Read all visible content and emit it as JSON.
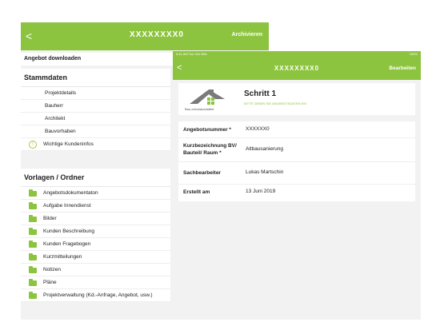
{
  "back": {
    "title": "XXXXXXXX0",
    "back_glyph": "<",
    "action": "Archivieren",
    "download": "Angebot downloaden",
    "stammdaten": {
      "title": "Stammdaten",
      "items": [
        "Projektdetails",
        "Bauherr",
        "Architekt",
        "Bauvorhaben"
      ],
      "info_item": "Wichtige Kundeninfos"
    },
    "vorlagen": {
      "title": "Vorlagen / Ordner",
      "items": [
        "Angebotsdokumentaton",
        "Aufgabe Innendienst",
        "Bilder",
        "Kunden Beschreibung",
        "Kunden Fragebogen",
        "Kurzmitteilungen",
        "Notizen",
        "Pläne",
        "Projektverwaltung (Kd.-Anfrage, Angebot, usw.)"
      ]
    }
  },
  "front": {
    "status_left": "9:41 AM  Tue Oct 30th",
    "status_right": "100%",
    "title": "XXXXXXXX0",
    "back_glyph": "<",
    "edit": "Bearbeiten",
    "logo_text": "Bau-checkausdwillet",
    "step_title": "Schritt 1",
    "step_sub": "BITTE GEBEN SIE ANGEBOTSDATEN EIN",
    "fields": [
      {
        "label": "Angebotsnummer *",
        "value": "XXXXXX0"
      },
      {
        "label": "Kurzbezeichnung BV/ Bauteil/ Raum *",
        "value": "Altbausanierung"
      },
      {
        "label": "Sachbearbeiter",
        "value": "Lukas Martschin"
      },
      {
        "label": "Erstellt am",
        "value": "13 Juni 2019"
      }
    ]
  },
  "colors": {
    "accent": "#8cc43f"
  }
}
